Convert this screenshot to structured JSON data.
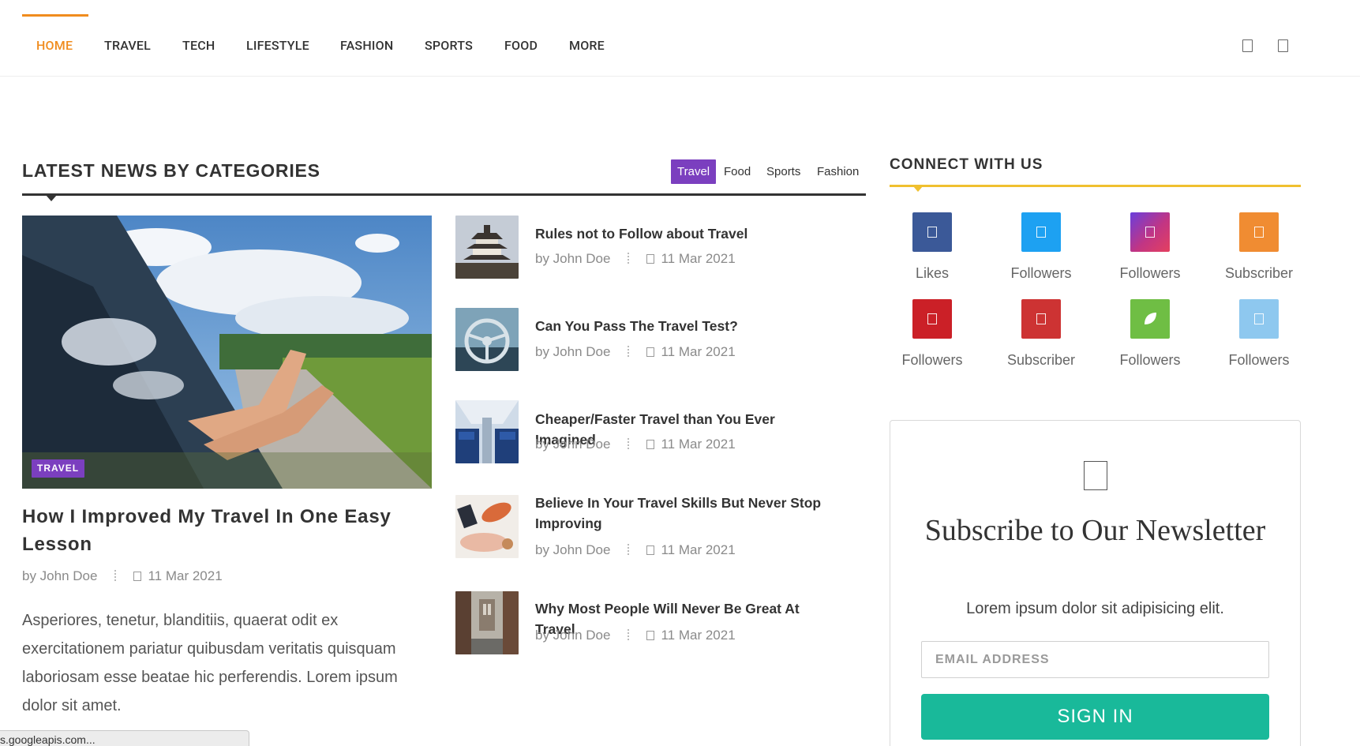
{
  "nav": {
    "items": [
      "HOME",
      "TRAVEL",
      "TECH",
      "LIFESTYLE",
      "FASHION",
      "SPORTS",
      "FOOD",
      "MORE"
    ],
    "active_index": 0
  },
  "section": {
    "title": "LATEST NEWS BY CATEGORIES",
    "tabs": [
      "Travel",
      "Food",
      "Sports",
      "Fashion"
    ],
    "active_tab_index": 0
  },
  "feature": {
    "tag": "TRAVEL",
    "title": "How I Improved My Travel In One Easy Lesson",
    "author": "by John Doe",
    "date": "11 Mar 2021",
    "excerpt": "Asperiores, tenetur, blanditiis, quaerat odit ex exercitationem pariatur quibusdam veritatis quisquam laboriosam esse beatae hic perferendis. Lorem ipsum dolor sit amet."
  },
  "side_posts": [
    {
      "title": "Rules not to Follow about Travel",
      "author": "by John Doe",
      "date": "11 Mar 2021",
      "thumb": "pagoda"
    },
    {
      "title": "Can You Pass The Travel Test?",
      "author": "by John Doe",
      "date": "11 Mar 2021",
      "thumb": "steering-wheel"
    },
    {
      "title": "Cheaper/Faster Travel than You Ever Imagined",
      "author": "by John Doe",
      "date": "11 Mar 2021",
      "thumb": "airplane-cabin"
    },
    {
      "title": "Believe In Your Travel Skills But Never Stop Improving",
      "author": "by John Doe",
      "date": "11 Mar 2021",
      "thumb": "flatlay"
    },
    {
      "title": "Why Most People Will Never Be Great At Travel",
      "author": "by John Doe",
      "date": "11 Mar 2021",
      "thumb": "bridge-street"
    }
  ],
  "connect": {
    "title": "CONNECT WITH US",
    "items": [
      {
        "label": "Likes",
        "color": "#3b5998",
        "icon": "facebook-icon"
      },
      {
        "label": "Followers",
        "color": "#1da1f2",
        "icon": "twitter-icon"
      },
      {
        "label": "Followers",
        "color": "#c13584",
        "icon": "instagram-icon"
      },
      {
        "label": "Subscriber",
        "color": "#f08c32",
        "icon": "rss-icon"
      },
      {
        "label": "Followers",
        "color": "#cb2027",
        "icon": "pinterest-icon"
      },
      {
        "label": "Subscriber",
        "color": "#cd3333",
        "icon": "youtube-icon"
      },
      {
        "label": "Followers",
        "color": "#6fbe44",
        "icon": "leaf-icon"
      },
      {
        "label": "Followers",
        "color": "#8ec8ef",
        "icon": "vimeo-icon"
      }
    ]
  },
  "newsletter": {
    "title": "Subscribe to Our Newsletter",
    "description": "Lorem ipsum dolor sit adipisicing elit.",
    "email_placeholder": "EMAIL ADDRESS",
    "button": "SIGN IN"
  },
  "status_bar": "s.googleapis.com..."
}
